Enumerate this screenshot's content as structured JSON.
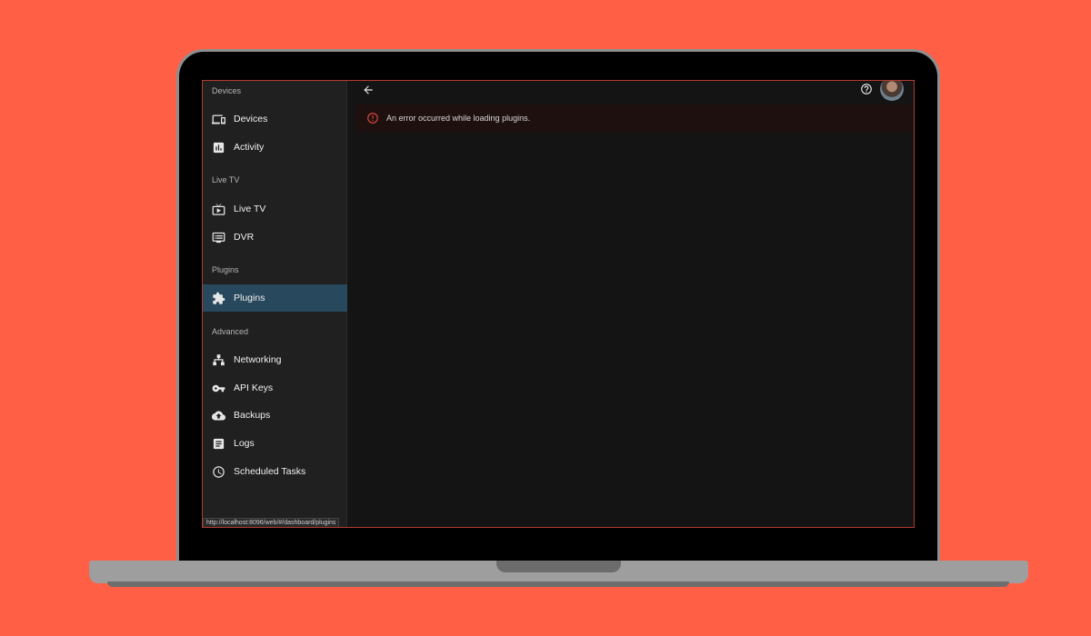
{
  "sidebar": {
    "sections": [
      {
        "header": "Devices",
        "items": [
          {
            "label": "Devices",
            "icon": "devices-icon"
          },
          {
            "label": "Activity",
            "icon": "activity-icon"
          }
        ]
      },
      {
        "header": "Live TV",
        "items": [
          {
            "label": "Live TV",
            "icon": "live-tv-icon"
          },
          {
            "label": "DVR",
            "icon": "dvr-icon"
          }
        ]
      },
      {
        "header": "Plugins",
        "items": [
          {
            "label": "Plugins",
            "icon": "puzzle-icon",
            "active": true
          }
        ]
      },
      {
        "header": "Advanced",
        "items": [
          {
            "label": "Networking",
            "icon": "network-icon"
          },
          {
            "label": "API Keys",
            "icon": "key-icon"
          },
          {
            "label": "Backups",
            "icon": "cloud-upload-icon"
          },
          {
            "label": "Logs",
            "icon": "document-icon"
          },
          {
            "label": "Scheduled Tasks",
            "icon": "clock-icon"
          }
        ]
      }
    ]
  },
  "header": {
    "back_icon": "arrow-left-icon",
    "help_icon": "help-circle-icon"
  },
  "alert": {
    "icon": "error-icon",
    "message": "An error occurred while loading plugins."
  },
  "status_bar": {
    "url": "http://localhost:8096/web/#/dashboard/plugins"
  },
  "colors": {
    "background": "#FF5F45",
    "active_item": "#28495d",
    "error_icon": "#e04a3e"
  }
}
